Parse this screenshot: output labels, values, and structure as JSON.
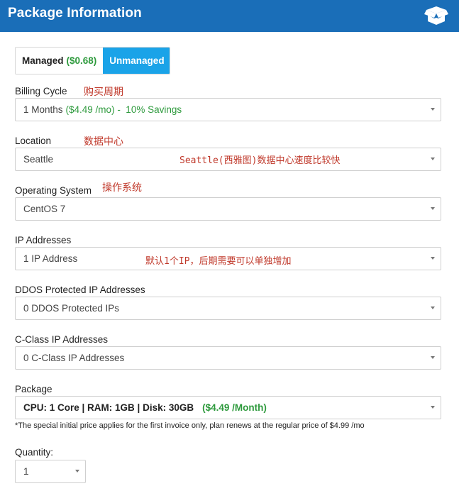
{
  "header": {
    "title": "Package Information",
    "icon": "open-box-icon"
  },
  "tabs": {
    "managed_label": "Managed",
    "managed_price": "($0.68)",
    "unmanaged_label": "Unmanaged",
    "active": "Unmanaged"
  },
  "billing": {
    "label": "Billing Cycle",
    "annotation": "购买周期",
    "value_prefix": "1 Months",
    "value_price": "($4.49 /mo)",
    "value_savings": " -  10% Savings"
  },
  "location": {
    "label": "Location",
    "annotation": "数据中心",
    "value": "Seattle",
    "inline_annotation": "Seattle(西雅图)数据中心速度比较快"
  },
  "os": {
    "label": "Operating System",
    "annotation": "操作系统",
    "value": "CentOS 7"
  },
  "ip": {
    "label": "IP Addresses",
    "value": "1 IP Address",
    "inline_annotation": "默认1个IP，后期需要可以单独增加"
  },
  "ddos": {
    "label": "DDOS Protected IP Addresses",
    "value": "0 DDOS Protected IPs"
  },
  "cclass": {
    "label": "C-Class IP Addresses",
    "value": "0 C-Class IP Addresses"
  },
  "package": {
    "label": "Package",
    "value_specs": "CPU: 1 Core | RAM: 1GB | Disk: 30GB",
    "value_price": "($4.49 /Month)",
    "note": "*The special initial price applies for the first invoice only, plan renews at the regular price of $4.99 /mo"
  },
  "quantity": {
    "label": "Quantity:",
    "value": "1"
  },
  "colors": {
    "header_bg": "#1a6eb8",
    "active_tab": "#1aa3e8",
    "price_green": "#2e9a3d",
    "annotation_red": "#c0392b"
  }
}
